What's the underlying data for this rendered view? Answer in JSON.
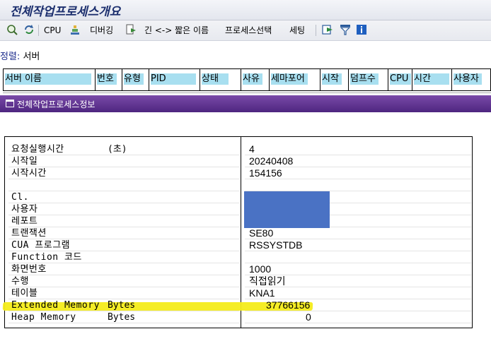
{
  "window": {
    "title": "전체작업프로세스개요"
  },
  "toolbar": {
    "cpu_label": "CPU",
    "debug_label": "디버깅",
    "toggle_names_label": "긴 <-> 짧은 이름",
    "process_select_label": "프로세스선택",
    "settings_label": "세팅"
  },
  "sort": {
    "label": "정렬:",
    "value": "서버"
  },
  "columns": [
    "서버 이름",
    "번호",
    "유형",
    "PID",
    "상태",
    "사유",
    "세마포어",
    "시작",
    "덤프수",
    "CPU",
    "시간",
    "사용자"
  ],
  "popup": {
    "title": "전체작업프로세스정보",
    "rows": [
      {
        "label": "요청실행시간",
        "unit": "(초)",
        "value": "4"
      },
      {
        "label": "시작일",
        "unit": "",
        "value": "20240408"
      },
      {
        "label": "시작시간",
        "unit": "",
        "value": "154156"
      },
      {
        "label": "",
        "unit": "",
        "value": ""
      },
      {
        "label": "Cl.",
        "unit": "",
        "value": ""
      },
      {
        "label": "사용자",
        "unit": "",
        "value": ""
      },
      {
        "label": "레포트",
        "unit": "",
        "value": ""
      },
      {
        "label": "트랜잭션",
        "unit": "",
        "value": "SE80"
      },
      {
        "label": "CUA 프로그램",
        "unit": "",
        "value": "RSSYSTDB"
      },
      {
        "label": "Function 코드",
        "unit": "",
        "value": ""
      },
      {
        "label": "화면번호",
        "unit": "",
        "value": "1000"
      },
      {
        "label": "수행",
        "unit": "",
        "value": "직접읽기"
      },
      {
        "label": "테이블",
        "unit": "",
        "value": "KNA1"
      },
      {
        "label": "Extended Memory",
        "unit": "Bytes",
        "value": "37766156"
      },
      {
        "label": "Heap Memory",
        "unit": "Bytes",
        "value": "0"
      }
    ]
  },
  "colors": {
    "header_highlight": "#a8dff0",
    "popup_title_bar": "#5a2e8c",
    "redaction": "#4a72c4",
    "marker_highlight": "#f4ec1a"
  },
  "icons": [
    "refresh-icon",
    "reload-icon",
    "cpu-icon",
    "debug-icon",
    "toggle-names-icon",
    "export-icon",
    "filter-icon",
    "info-icon",
    "popup-window-icon"
  ]
}
